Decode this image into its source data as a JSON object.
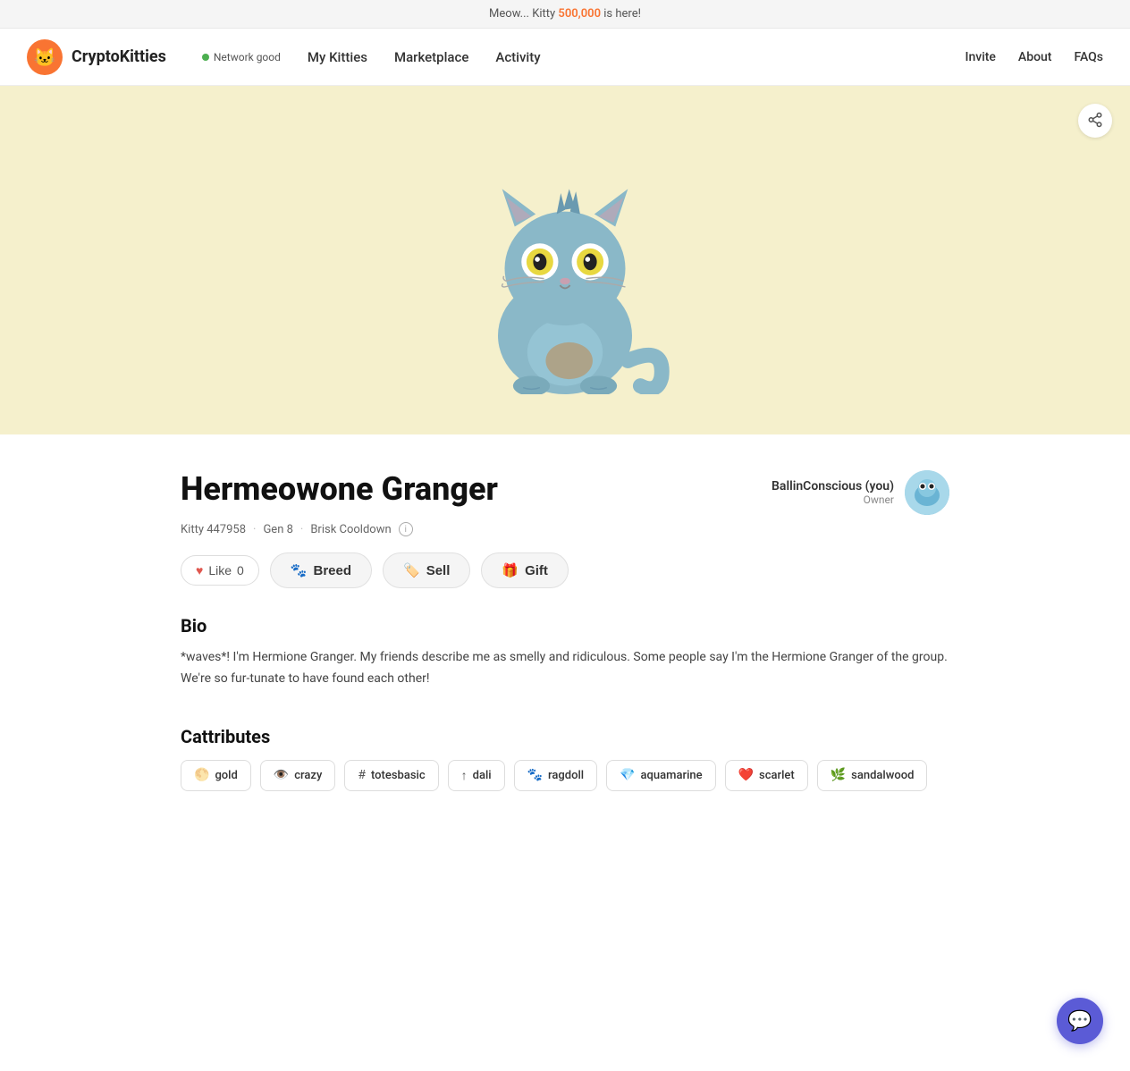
{
  "banner": {
    "text_prefix": "Meow... Kitty ",
    "highlight": "500,000",
    "text_suffix": " is here!"
  },
  "navbar": {
    "brand": "CryptoKitties",
    "brand_emoji": "🐱",
    "network_label": "Network good",
    "links": [
      {
        "label": "My Kitties",
        "name": "my-kitties"
      },
      {
        "label": "Marketplace",
        "name": "marketplace"
      },
      {
        "label": "Activity",
        "name": "activity"
      }
    ],
    "right_links": [
      {
        "label": "Invite",
        "name": "invite"
      },
      {
        "label": "About",
        "name": "about"
      },
      {
        "label": "FAQs",
        "name": "faqs"
      }
    ]
  },
  "kitty": {
    "name": "Hermeowone Granger",
    "id": "Kitty 447958",
    "gen": "Gen 8",
    "cooldown": "Brisk Cooldown",
    "like_count": "0",
    "owner_name": "BallinConscious (you)",
    "owner_role": "Owner",
    "bio_title": "Bio",
    "bio_text": "*waves*! I'm Hermione Granger. My friends describe me as smelly and ridiculous. Some people say I'm the Hermione Granger of the group. We're so fur-tunate to have found each other!",
    "cattributes_title": "Cattributes",
    "buttons": {
      "breed": "Breed",
      "sell": "Sell",
      "gift": "Gift",
      "like": "Like"
    },
    "cattributes": [
      {
        "icon": "🌕",
        "name": "gold"
      },
      {
        "icon": "👁️",
        "name": "crazy"
      },
      {
        "icon": "#",
        "name": "totesbasic"
      },
      {
        "icon": "↑",
        "name": "dali"
      },
      {
        "icon": "🐾",
        "name": "ragdoll"
      },
      {
        "icon": "💎",
        "name": "aquamarine"
      },
      {
        "icon": "❤️",
        "name": "scarlet"
      },
      {
        "icon": "🌿",
        "name": "sandalwood"
      }
    ]
  },
  "icons": {
    "share": "⤴",
    "heart": "♥",
    "breed": "🐾",
    "sell": "🏷️",
    "gift": "🎁",
    "chat": "💬",
    "info": "i"
  }
}
